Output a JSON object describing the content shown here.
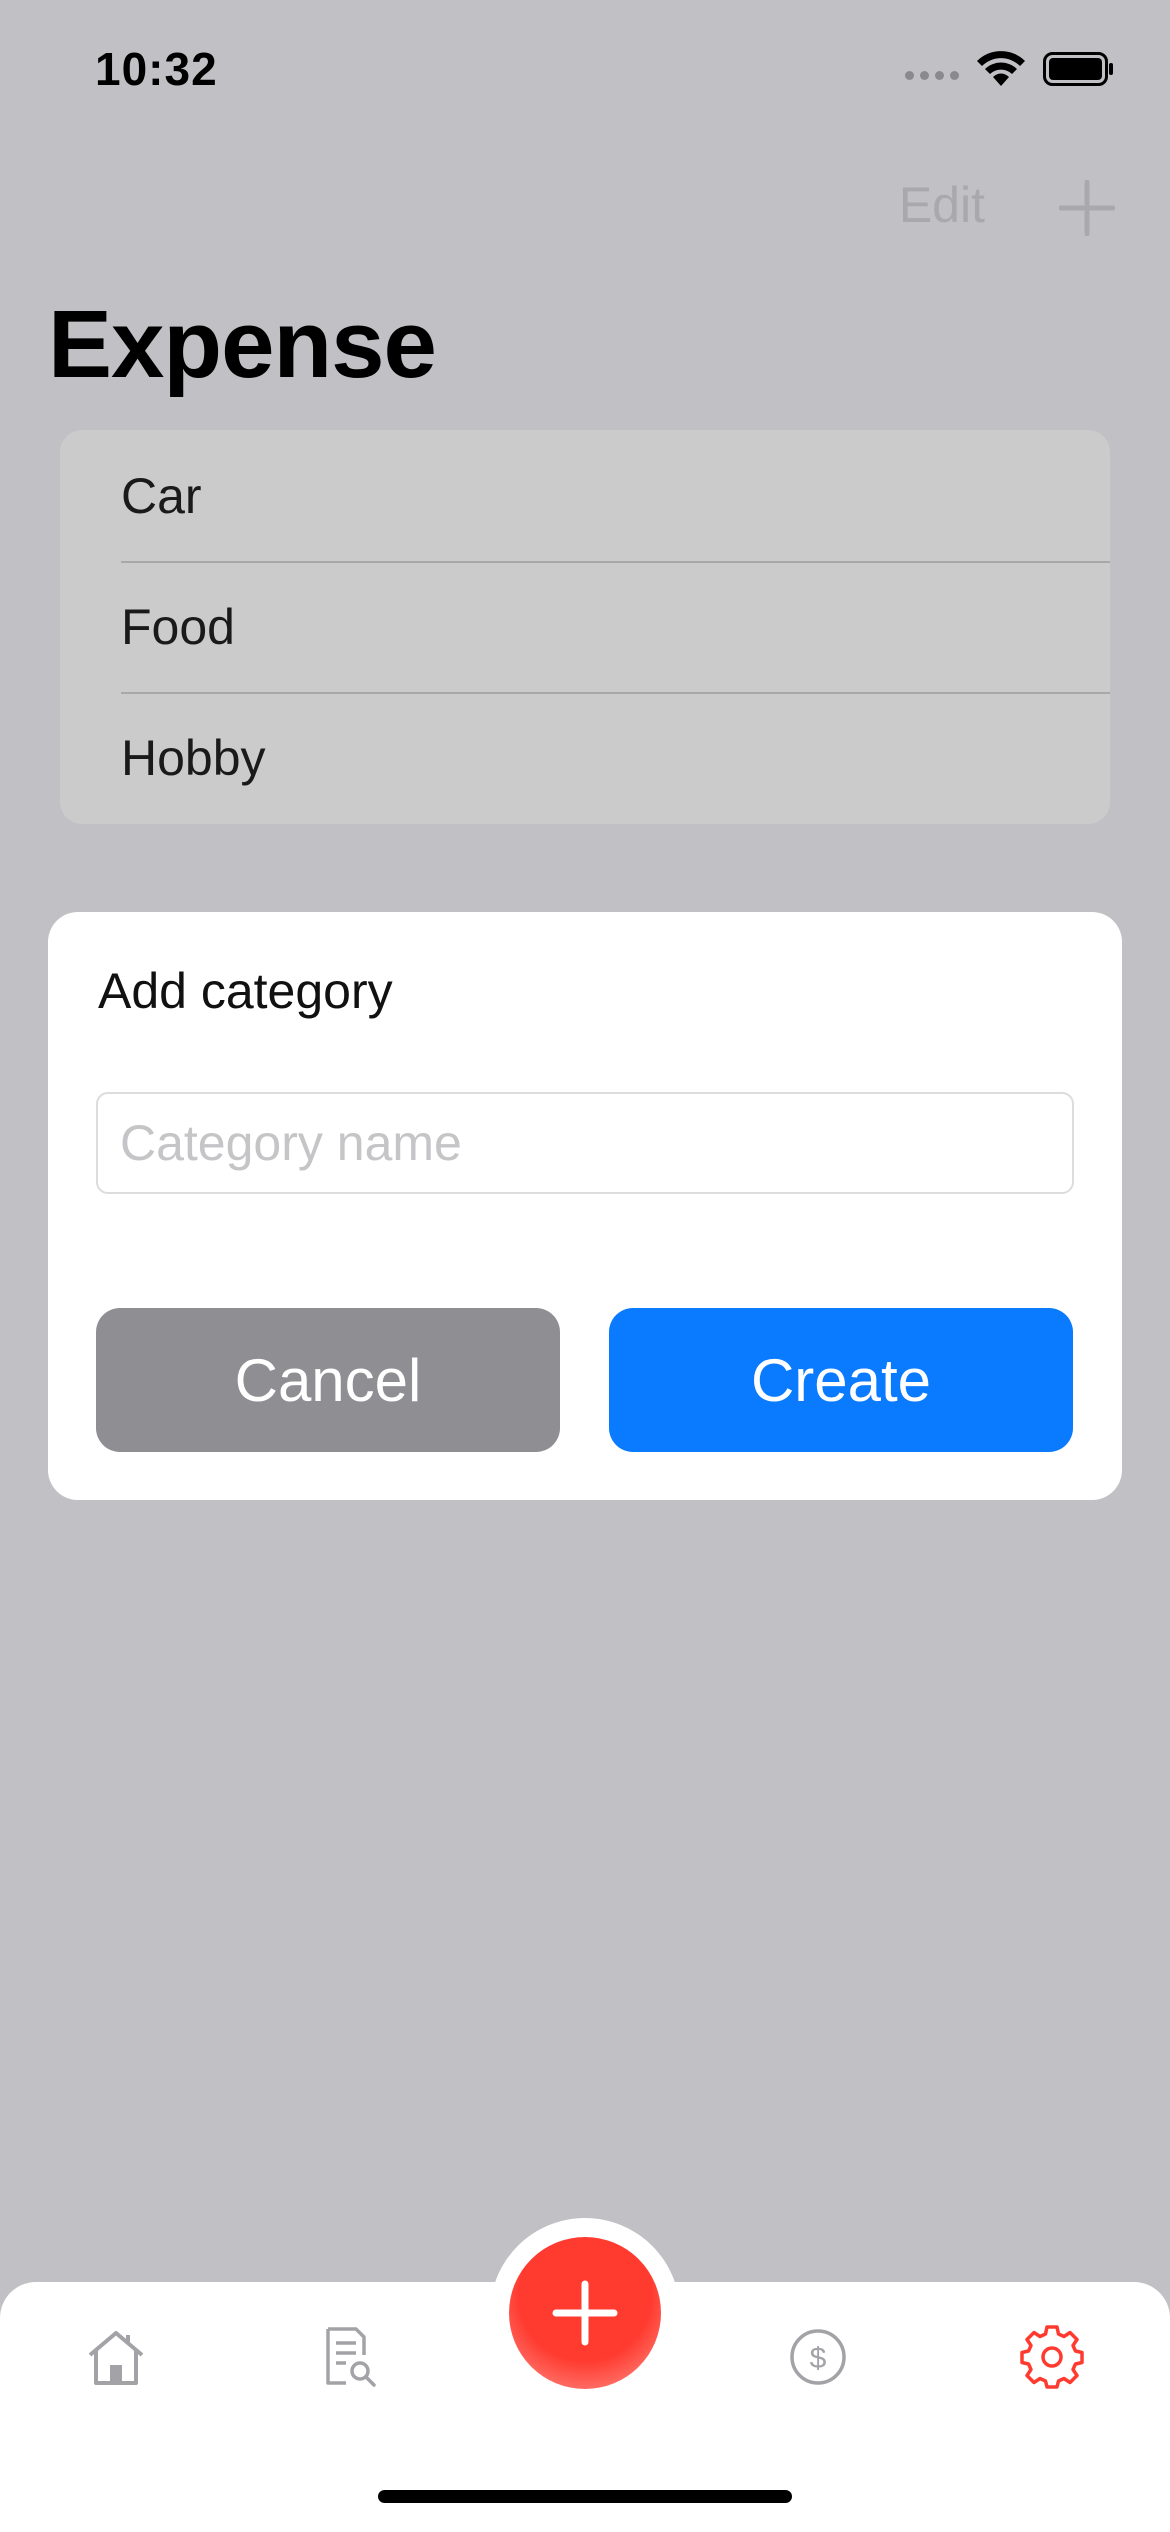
{
  "status_bar": {
    "time": "10:32"
  },
  "nav": {
    "edit_label": "Edit",
    "add_icon": "plus-icon"
  },
  "page": {
    "title": "Expense"
  },
  "categories": [
    {
      "label": "Car"
    },
    {
      "label": "Food"
    },
    {
      "label": "Hobby"
    }
  ],
  "dialog": {
    "title": "Add category",
    "input_value": "",
    "input_placeholder": "Category name",
    "cancel_label": "Cancel",
    "create_label": "Create"
  },
  "tab_bar": {
    "items": [
      {
        "icon": "home-icon",
        "active": false
      },
      {
        "icon": "report-search-icon",
        "active": false
      },
      {
        "icon": "plus-icon",
        "active": false
      },
      {
        "icon": "dollar-icon",
        "active": false
      },
      {
        "icon": "gear-icon",
        "active": true
      }
    ]
  },
  "colors": {
    "accent_blue": "#0a7bff",
    "accent_red": "#ff3b30",
    "cancel_gray": "#8e8e93",
    "overlay_background": "#c1c0c5"
  }
}
